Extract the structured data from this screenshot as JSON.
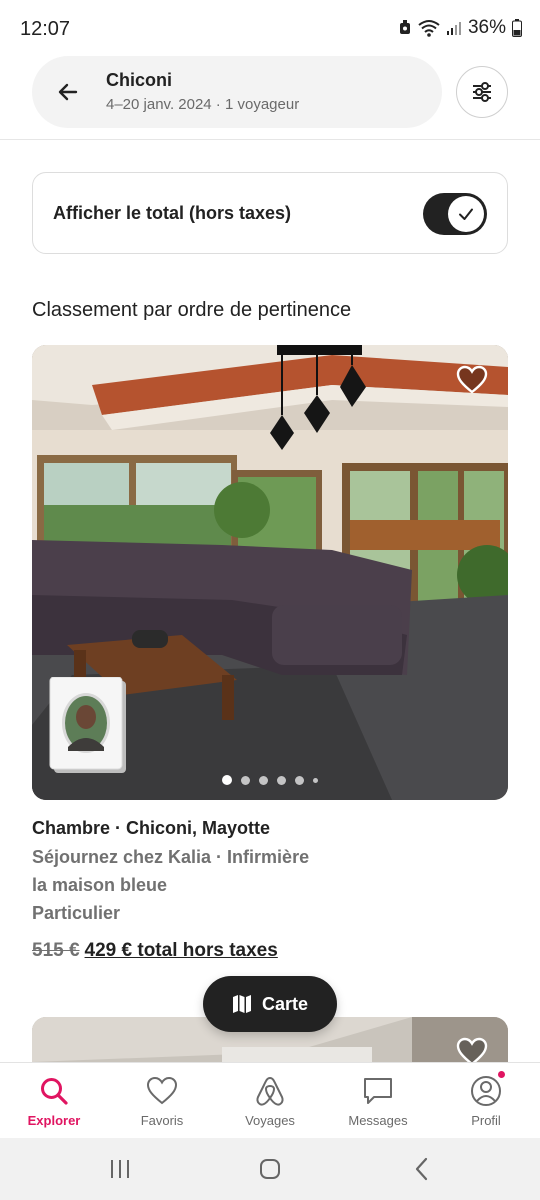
{
  "status_bar": {
    "time": "12:07",
    "battery": "36%",
    "icons": [
      "alarm-icon",
      "wifi-icon",
      "signal-icon",
      "battery-icon"
    ]
  },
  "search": {
    "location": "Chiconi",
    "details": "4–20 janv. 2024 · 1 voyageur"
  },
  "total_toggle": {
    "label": "Afficher le total (hors taxes)",
    "enabled": true
  },
  "sort_heading": "Classement par ordre de pertinence",
  "listing": {
    "title": "Chambre · Chiconi, Mayotte",
    "host_line": "Séjournez chez Kalia · Infirmière",
    "name": "la maison bleue",
    "host_type": "Particulier",
    "price_old": "515 €",
    "price_new": "429 € total hors taxes",
    "photo_count_dots": 6,
    "active_photo": 0
  },
  "map_button": {
    "label": "Carte"
  },
  "bottom_nav": {
    "items": [
      {
        "label": "Explorer",
        "icon": "search-icon",
        "active": true
      },
      {
        "label": "Favoris",
        "icon": "heart-icon",
        "active": false
      },
      {
        "label": "Voyages",
        "icon": "airbnb-logo-icon",
        "active": false
      },
      {
        "label": "Messages",
        "icon": "message-icon",
        "active": false
      },
      {
        "label": "Profil",
        "icon": "profile-icon",
        "active": false,
        "notification": true
      }
    ]
  },
  "colors": {
    "brand": "#e01561",
    "text": "#222222",
    "muted": "#717171"
  }
}
